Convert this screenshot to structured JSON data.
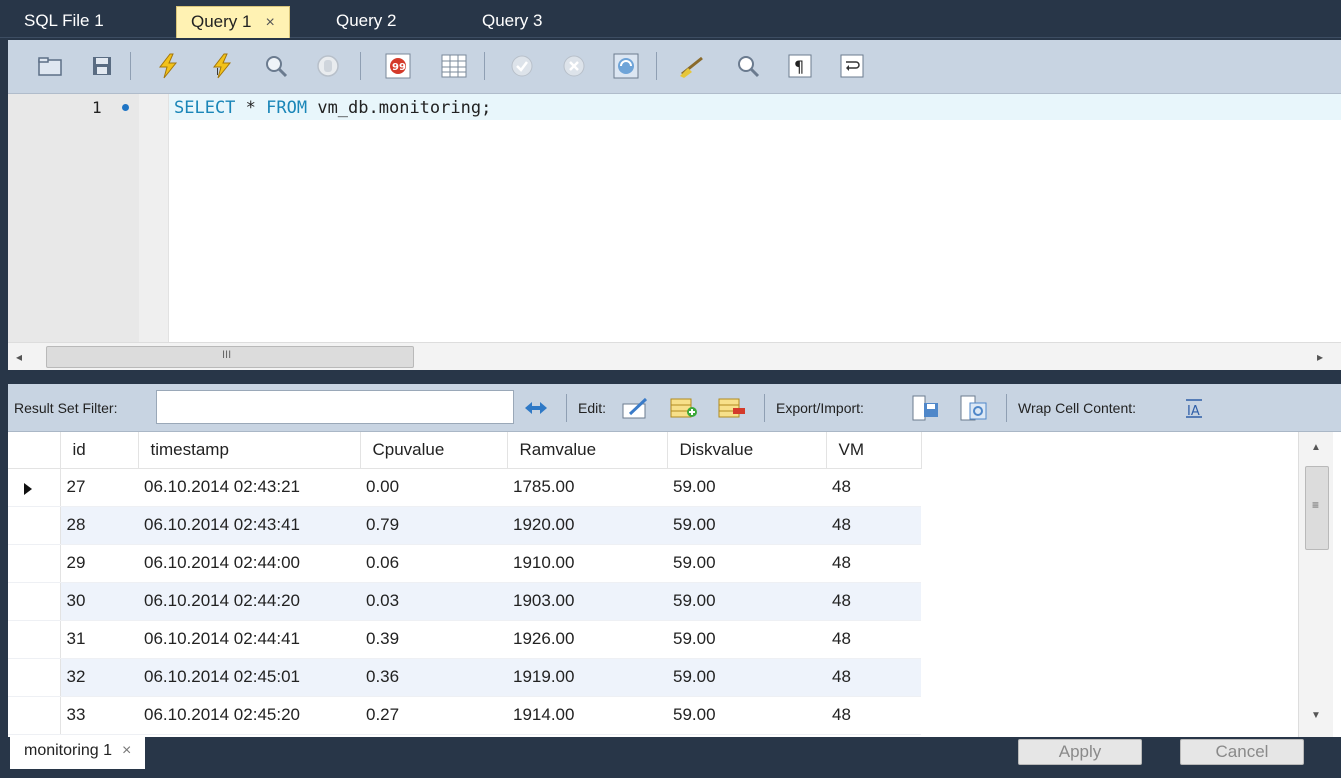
{
  "tabs": [
    {
      "label": "SQL File 1",
      "active": false
    },
    {
      "label": "Query 1",
      "active": true,
      "close": "×"
    },
    {
      "label": "Query 2",
      "active": false
    },
    {
      "label": "Query 3",
      "active": false
    }
  ],
  "editor": {
    "line_number": "1",
    "code": {
      "kw1": "SELECT",
      "mid": " * ",
      "kw2": "FROM",
      "rest": " vm_db.monitoring;"
    }
  },
  "hscroll": {
    "left": "◂",
    "right": "▸",
    "grip": "III"
  },
  "filter": {
    "label": "Result Set Filter:",
    "value": "",
    "edit_label": "Edit:",
    "export_label": "Export/Import:",
    "wrap_label": "Wrap Cell Content:"
  },
  "grid": {
    "columns": [
      "id",
      "timestamp",
      "Cpuvalue",
      "Ramvalue",
      "Diskvalue",
      "VM"
    ],
    "rows": [
      [
        "27",
        "06.10.2014 02:43:21",
        "0.00",
        "1785.00",
        "59.00",
        "48"
      ],
      [
        "28",
        "06.10.2014 02:43:41",
        "0.79",
        "1920.00",
        "59.00",
        "48"
      ],
      [
        "29",
        "06.10.2014 02:44:00",
        "0.06",
        "1910.00",
        "59.00",
        "48"
      ],
      [
        "30",
        "06.10.2014 02:44:20",
        "0.03",
        "1903.00",
        "59.00",
        "48"
      ],
      [
        "31",
        "06.10.2014 02:44:41",
        "0.39",
        "1926.00",
        "59.00",
        "48"
      ],
      [
        "32",
        "06.10.2014 02:45:01",
        "0.36",
        "1919.00",
        "59.00",
        "48"
      ],
      [
        "33",
        "06.10.2014 02:45:20",
        "0.27",
        "1914.00",
        "59.00",
        "48"
      ]
    ]
  },
  "vscroll": {
    "up": "▲",
    "down": "▼",
    "grip": "≡"
  },
  "bottom": {
    "tab_label": "monitoring 1",
    "tab_close": "×",
    "apply": "Apply",
    "cancel": "Cancel"
  },
  "colors": {
    "accent_tab": "#fff2b3",
    "chrome": "#283648",
    "toolbar": "#c8d4e2",
    "keyword": "#1a86b8"
  }
}
